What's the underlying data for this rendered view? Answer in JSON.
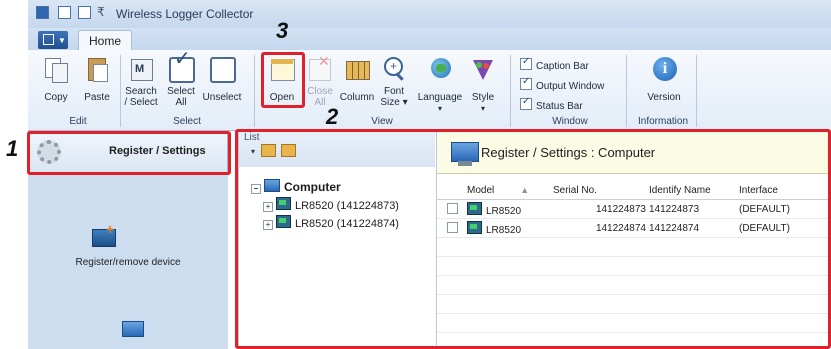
{
  "window": {
    "title": "Wireless Logger Collector"
  },
  "ribbon": {
    "tab": "Home",
    "groups": [
      {
        "name": "Edit",
        "buttons": [
          "Copy",
          "Paste"
        ]
      },
      {
        "name": "Select",
        "buttons": [
          "Search / Select",
          "Select All",
          "Unselect"
        ]
      },
      {
        "name": "View",
        "buttons": [
          "Open",
          "Close All",
          "Column",
          "Font Size ▾",
          "Language ▾",
          "Style ▾"
        ]
      },
      {
        "name": "Window",
        "checkboxes": [
          "Caption Bar",
          "Output Window",
          "Status Bar"
        ]
      },
      {
        "name": "Information",
        "buttons": [
          "Version"
        ]
      }
    ]
  },
  "callouts": {
    "one": "1",
    "two": "2",
    "three": "3"
  },
  "sidebar": {
    "register_settings": "Register / Settings",
    "register_remove": "Register/remove device"
  },
  "list": {
    "title": "List",
    "root": "Computer",
    "items": [
      "LR8520 (141224873)",
      "LR8520 (141224874)"
    ]
  },
  "detail": {
    "title": "Register / Settings : Computer",
    "columns": [
      "Model",
      "Serial No.",
      "Identify Name",
      "Interface"
    ],
    "rows": [
      {
        "model": "LR8520",
        "serial": "141224873",
        "identify": "141224873",
        "interface": "(DEFAULT)"
      },
      {
        "model": "LR8520",
        "serial": "141224874",
        "identify": "141224874",
        "interface": "(DEFAULT)"
      }
    ]
  }
}
